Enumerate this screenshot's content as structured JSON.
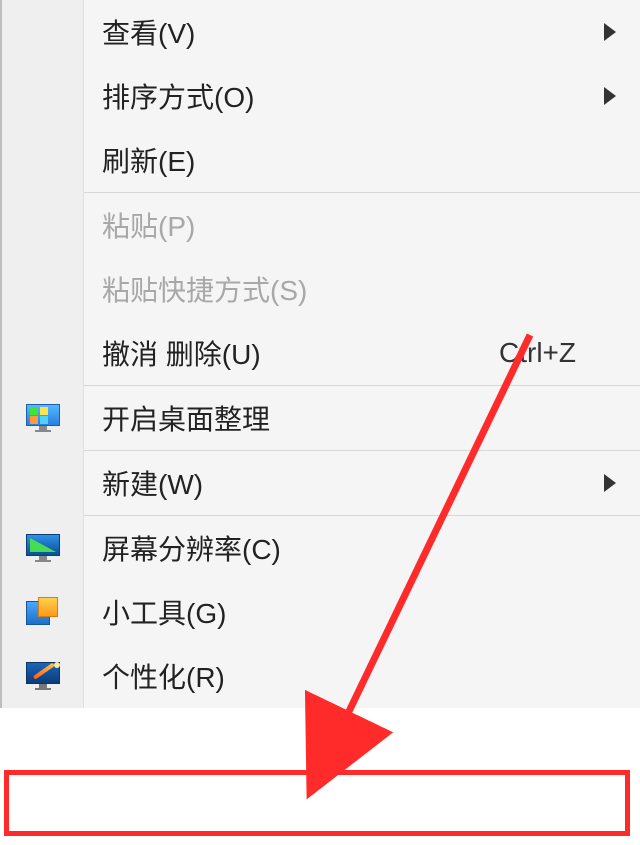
{
  "menu": {
    "items": [
      {
        "label": "查看(V)",
        "submenu": true
      },
      {
        "label": "排序方式(O)",
        "submenu": true
      },
      {
        "label": "刷新(E)"
      },
      {
        "separator": true
      },
      {
        "label": "粘贴(P)",
        "disabled": true
      },
      {
        "label": "粘贴快捷方式(S)",
        "disabled": true
      },
      {
        "label": "撤消 删除(U)",
        "shortcut": "Ctrl+Z"
      },
      {
        "separator": true
      },
      {
        "label": "开启桌面整理",
        "icon": "monitor-tiles"
      },
      {
        "separator": true
      },
      {
        "label": "新建(W)",
        "submenu": true
      },
      {
        "separator": true
      },
      {
        "label": "屏幕分辨率(C)",
        "icon": "monitor-res"
      },
      {
        "label": "小工具(G)",
        "icon": "gadgets"
      },
      {
        "label": "个性化(R)",
        "icon": "personalize"
      }
    ]
  },
  "annotation": {
    "highlight_target": "个性化(R)",
    "highlight_color": "#ff2a2a"
  }
}
